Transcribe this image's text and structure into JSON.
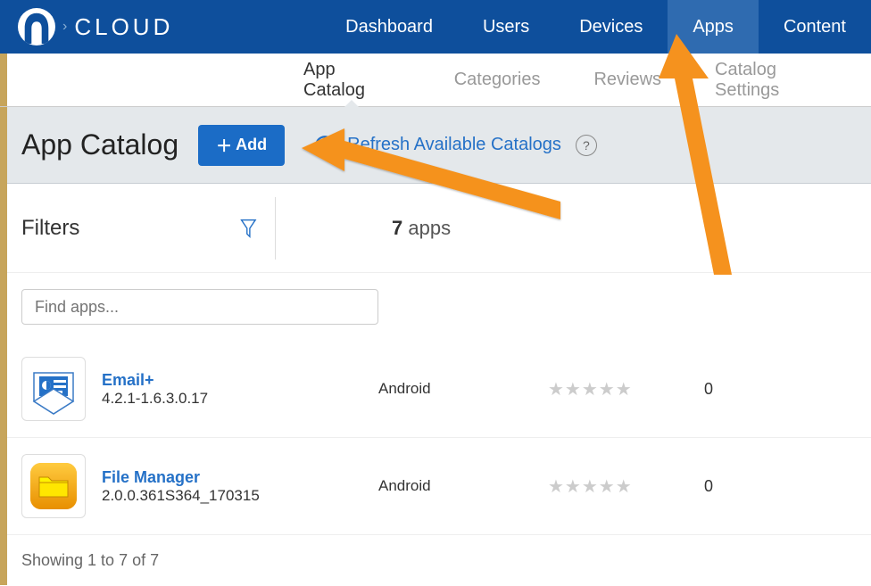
{
  "brand": {
    "name": "CLOUD"
  },
  "nav": {
    "items": [
      {
        "label": "Dashboard",
        "active": false
      },
      {
        "label": "Users",
        "active": false
      },
      {
        "label": "Devices",
        "active": false
      },
      {
        "label": "Apps",
        "active": true
      },
      {
        "label": "Content",
        "active": false
      }
    ]
  },
  "subnav": {
    "items": [
      {
        "label": "App Catalog",
        "active": true
      },
      {
        "label": "Categories",
        "active": false
      },
      {
        "label": "Reviews",
        "active": false
      },
      {
        "label": "Catalog Settings",
        "active": false
      }
    ]
  },
  "titlebar": {
    "title": "App Catalog",
    "add_label": "Add",
    "refresh_label": "Refresh Available Catalogs",
    "help_glyph": "?"
  },
  "filterbar": {
    "label": "Filters",
    "count": "7",
    "count_suffix": "apps"
  },
  "search": {
    "placeholder": "Find apps..."
  },
  "apps": [
    {
      "name": "Email+",
      "version": "4.2.1-1.6.3.0.17",
      "platform": "Android",
      "rating": "★★★★★",
      "count": "0",
      "icon": "email"
    },
    {
      "name": "File Manager",
      "version": "2.0.0.361S364_170315",
      "platform": "Android",
      "rating": "★★★★★",
      "count": "0",
      "icon": "folder"
    }
  ],
  "footer": {
    "text": "Showing 1 to 7 of 7"
  }
}
